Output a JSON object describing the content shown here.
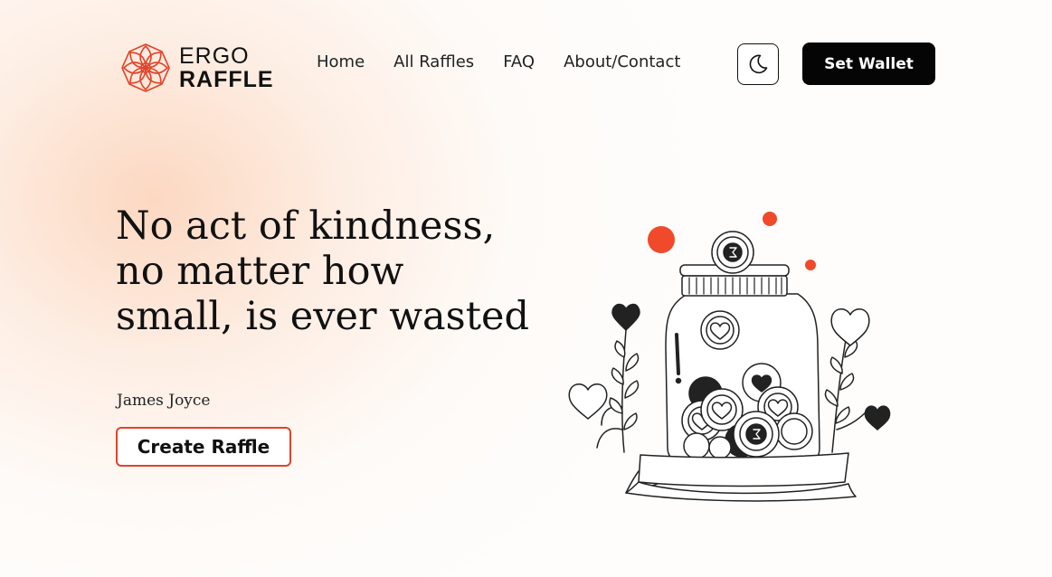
{
  "header": {
    "logo": {
      "line1": "ERGO",
      "line2": "RAFFLE",
      "icon": "lotus-mandala-icon",
      "color": "#e0442b"
    },
    "nav": [
      {
        "label": "Home"
      },
      {
        "label": "All Raffles"
      },
      {
        "label": "FAQ"
      },
      {
        "label": "About/Contact"
      }
    ],
    "theme_toggle_icon": "moon-icon",
    "wallet_button_label": "Set Wallet"
  },
  "hero": {
    "quote": "No act of kindness, no matter how small, is ever wasted",
    "author": "James Joyce",
    "cta_label": "Create Raffle",
    "illustration_icon": "coin-jar-icon"
  },
  "colors": {
    "accent": "#e0442b",
    "dark": "#050505",
    "background_glow": "#fcd6be"
  }
}
